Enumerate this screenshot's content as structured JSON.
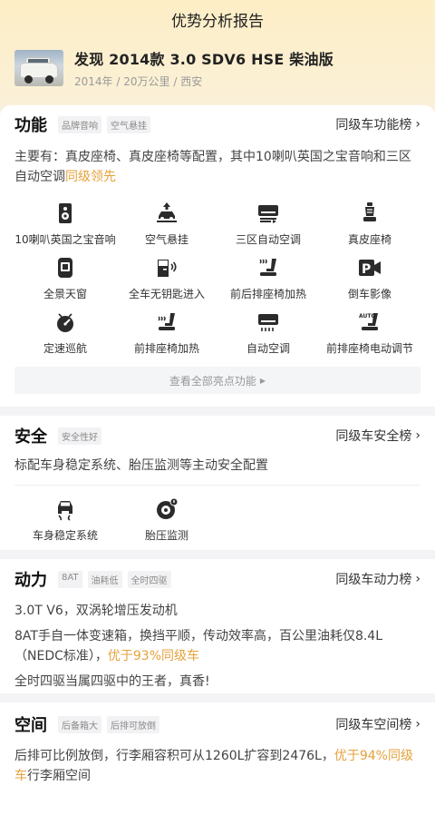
{
  "page_title": "优势分析报告",
  "car": {
    "name": "发现 2014款 3.0 SDV6 HSE 柴油版",
    "year": "2014年",
    "mileage": "20万公里",
    "city": "西安",
    "sep": "/"
  },
  "function": {
    "title": "功能",
    "tags": [
      "品牌音响",
      "空气悬挂"
    ],
    "rank_label": "同级车功能榜",
    "desc_prefix": "主要有：真皮座椅、真皮座椅等配置，其中10喇叭英国之宝音响和三区自动空调",
    "desc_highlight": "同级领先",
    "features": [
      {
        "label": "10喇叭英国之宝音响",
        "icon": "speaker-icon"
      },
      {
        "label": "空气悬挂",
        "icon": "air-suspension-icon"
      },
      {
        "label": "三区自动空调",
        "icon": "ac-zone-icon"
      },
      {
        "label": "真皮座椅",
        "icon": "leather-seat-icon"
      },
      {
        "label": "全景天窗",
        "icon": "sunroof-icon"
      },
      {
        "label": "全车无钥匙进入",
        "icon": "keyless-entry-icon"
      },
      {
        "label": "前后排座椅加热",
        "icon": "seat-heat-front-rear-icon"
      },
      {
        "label": "倒车影像",
        "icon": "reverse-camera-icon"
      },
      {
        "label": "定速巡航",
        "icon": "cruise-control-icon"
      },
      {
        "label": "前排座椅加热",
        "icon": "front-seat-heat-icon"
      },
      {
        "label": "自动空调",
        "icon": "auto-ac-icon"
      },
      {
        "label": "前排座椅电动调节",
        "icon": "power-seat-icon"
      }
    ],
    "more_label": "查看全部亮点功能"
  },
  "safety": {
    "title": "安全",
    "tags": [
      "安全性好"
    ],
    "rank_label": "同级车安全榜",
    "desc": "标配车身稳定系统、胎压监测等主动安全配置",
    "features": [
      {
        "label": "车身稳定系统",
        "icon": "stability-control-icon"
      },
      {
        "label": "胎压监测",
        "icon": "tire-pressure-icon"
      }
    ]
  },
  "power": {
    "title": "动力",
    "tags": [
      "8AT",
      "油耗低",
      "全时四驱"
    ],
    "rank_label": "同级车动力榜",
    "engine": "3.0T V6，双涡轮增压发动机",
    "trans_prefix": "8AT手自一体变速箱，换挡平顺，传动效率高，百公里油耗仅8.4L（NEDC标准），",
    "trans_highlight": "优于93%同级车",
    "awd": "全时四驱当属四驱中的王者，真香!"
  },
  "space": {
    "title": "空间",
    "tags": [
      "后备箱大",
      "后排可放倒"
    ],
    "rank_label": "同级车空间榜",
    "desc_prefix": "后排可比例放倒，行李厢容积可从1260L扩容到2476L，",
    "desc_highlight": "优于94%同级车",
    "desc_suffix": "行李厢空间"
  },
  "colors": {
    "accent": "#e6a23c",
    "header_gradient_top": "#fdeec6"
  }
}
